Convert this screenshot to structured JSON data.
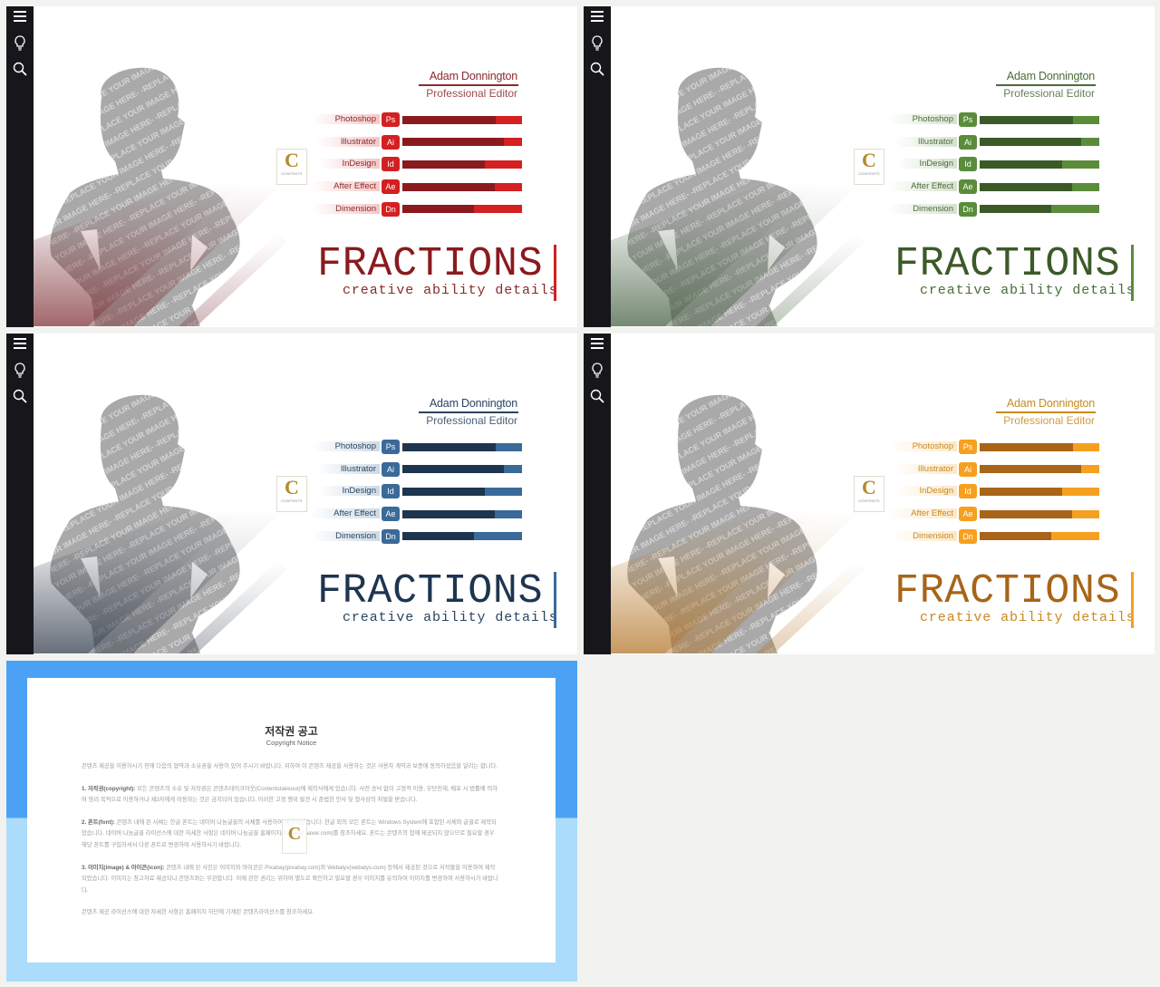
{
  "sidebar_icons": [
    "menu-icon",
    "lightbulb-icon",
    "search-icon"
  ],
  "slide_common": {
    "name": "Adam Donnington",
    "role": "Professional Editor",
    "title": "FRACTIONS",
    "subtitle": "creative ability details",
    "placeholder_text": "-REPLACE YOUR IMAGE HERE-",
    "logo_letter": "C",
    "logo_text": "CONTENTS",
    "skills": [
      {
        "label": "Photoshop",
        "badge": "Ps",
        "level": 0.78
      },
      {
        "label": "Illustrator",
        "badge": "Ai",
        "level": 0.85
      },
      {
        "label": "InDesign",
        "badge": "Id",
        "level": 0.69
      },
      {
        "label": "After Effect",
        "badge": "Ae",
        "level": 0.77
      },
      {
        "label": "Dimension",
        "badge": "Dn",
        "level": 0.6
      }
    ]
  },
  "slides": [
    {
      "theme": "red",
      "accent": "#d42020",
      "dark": "#8a1a1e",
      "text": "#8a2a2e",
      "tint": "#7a2a30"
    },
    {
      "theme": "green",
      "accent": "#5a8c3a",
      "dark": "#3b5a28",
      "text": "#4a6b3a",
      "tint": "#3f5a3a"
    },
    {
      "theme": "blue",
      "accent": "#3a6a99",
      "dark": "#1e3550",
      "text": "#2a4560",
      "tint": "#2a3545"
    },
    {
      "theme": "orange",
      "accent": "#f5a020",
      "dark": "#a86418",
      "text": "#c88a20",
      "tint": "#b07020"
    }
  ],
  "notice": {
    "title": "저작권 공고",
    "subtitle": "Copyright Notice",
    "logo_letter": "C",
    "intro": "콘텐츠 제공을 이용하시기 전에 다음의 협약과 소유권을 사용이 있어 주시기 바랍니다. 위하여 이 콘텐츠 제공을 사용하는 것은 사용자 계약과 보증에 동의하셨음을 알리는 합니다.",
    "sections": [
      {
        "heading": "1. 저작권(copyright):",
        "text": "모든 콘텐츠의 소유 및 저작권은 콘텐츠테이크아웃(Contentstakeout)에 제작사에게 있습니다. 사전 승낙 없이 고정적 이용, 무단전재, 배포 시 법률에 의하여 영리 목적으로 이용하거나 제3자에게 이용하는 것은 금지되어 있습니다. 이러한 고정 행위 발견 시 준법한 민사 및 형사상의 처벌을 받습니다."
      },
      {
        "heading": "2. 폰트(font):",
        "text": "콘텐츠 내에 된 서체는 한글 폰트는 네이버 나눔글꼴의 서체를 사용하여 제작되었습니다. 한글 외의 모든 폰트는 Windows System에 포함된 서체와 글꼴로 제작되었습니다. 네이버 나눔글꼴 라이선스에 대한 자세한 사항은 네이버 나눔글꼴 홈페이지(hangeul.naver.com)를 참조하세요. 폰트는 콘텐츠의 함께 제공되지 않으므로 필요할 경우 해당 폰트를 구입하셔서 다른 폰트로 변경하여 사용하시기 바랍니다."
      },
      {
        "heading": "3. 이미지(image) & 아이콘(icon):",
        "text": "콘텐츠 내에 된 사진은 이미지와 아이콘은 Pixabay(pixabay.com)와 Webalys(webalys.com) 등에서 제공된 것으로 저작물을 이용하여 제작되었습니다. 이미지는 참고자료 제공되나 콘텐츠와는 무관합니다. 이에 관한 권리는 위하여 별도로 확인하고 필요할 경우 이미지를 유의하여 이미지를 변경하여 사용하시기 바랍니다."
      }
    ],
    "footer": "콘텐츠 제공 라이선스에 대한 자세한 사항은 홈페이지 하단에 기재된 콘텐츠라이선스를 참조하세요."
  }
}
